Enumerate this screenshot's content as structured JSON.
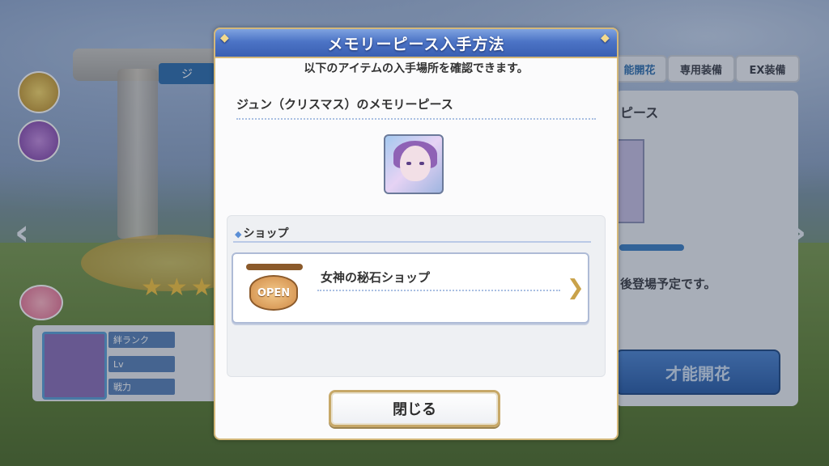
{
  "background": {
    "tabs": [
      "能開花",
      "専用装備",
      "EX装備"
    ],
    "panel_title": "ピース",
    "panel_text": "後登場予定です。",
    "big_button_label": "才能開花",
    "stats": [
      "絆ランク",
      "Lv",
      "戦力"
    ],
    "nav_left": "‹",
    "nav_right": "›",
    "side_label": "ジ"
  },
  "modal": {
    "title": "メモリーピース入手方法",
    "subtitle": "以下のアイテムの入手場所を確認できます。",
    "item_name": "ジュン（クリスマス）のメモリーピース",
    "source_section_label": "ショップ",
    "sources": [
      {
        "sign_text": "OPEN",
        "name": "女神の秘石ショップ"
      }
    ],
    "close_label": "閉じる"
  },
  "colors": {
    "header_blue": "#4c74c6",
    "gold_border": "#d4b87a",
    "dotted_blue": "#a9bfe2"
  },
  "icons": {
    "diamond": "◆",
    "arrow": "❯"
  }
}
